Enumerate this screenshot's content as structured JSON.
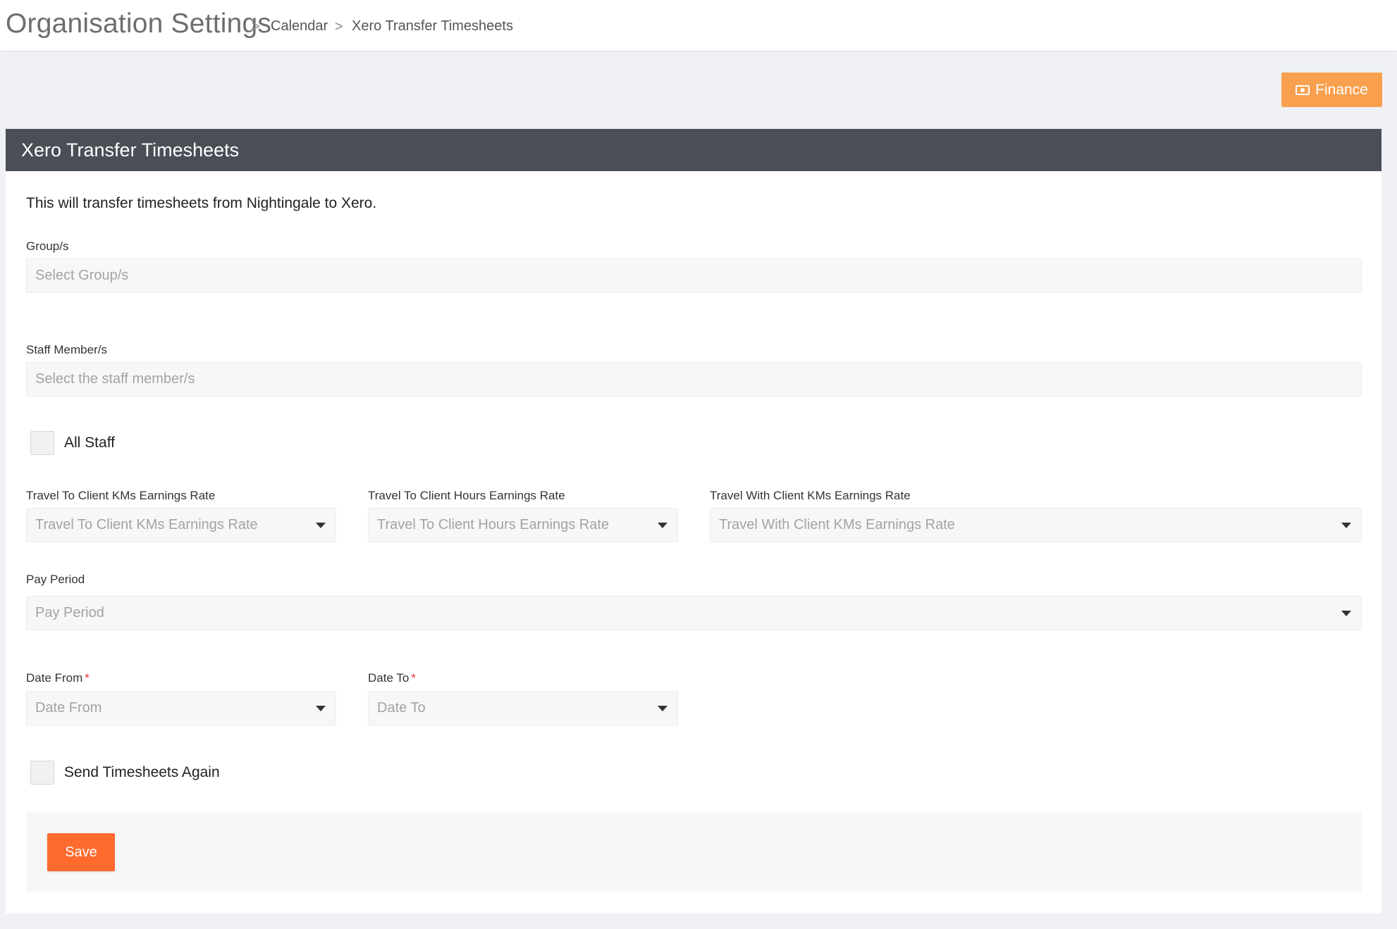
{
  "header": {
    "title": "Organisation Settings",
    "breadcrumb": [
      "Calendar",
      "Xero Transfer Timesheets"
    ],
    "separator": ">"
  },
  "finance_button": {
    "label": "Finance",
    "icon": "money-icon",
    "color": "#f8a04e"
  },
  "panel": {
    "title": "Xero Transfer Timesheets",
    "description": "This will transfer timesheets from Nightingale to Xero."
  },
  "form": {
    "groups": {
      "label": "Group/s",
      "placeholder": "Select Group/s"
    },
    "staff": {
      "label": "Staff Member/s",
      "placeholder": "Select the staff member/s"
    },
    "all_staff": {
      "label": "All Staff",
      "checked": false
    },
    "travel_to_client_kms": {
      "label": "Travel To Client KMs Earnings Rate",
      "placeholder": "Travel To Client KMs Earnings Rate"
    },
    "travel_to_client_hours": {
      "label": "Travel To Client Hours Earnings Rate",
      "placeholder": "Travel To Client Hours Earnings Rate"
    },
    "travel_with_client_kms": {
      "label": "Travel With Client KMs Earnings Rate",
      "placeholder": "Travel With Client KMs Earnings Rate"
    },
    "pay_period": {
      "label": "Pay Period",
      "placeholder": "Pay Period"
    },
    "date_from": {
      "label": "Date From",
      "placeholder": "Date From",
      "required_mark": "*"
    },
    "date_to": {
      "label": "Date To",
      "placeholder": "Date To",
      "required_mark": "*"
    },
    "send_again": {
      "label": "Send Timesheets Again",
      "checked": false
    }
  },
  "save_button": {
    "label": "Save",
    "color": "#ff6a2f"
  }
}
